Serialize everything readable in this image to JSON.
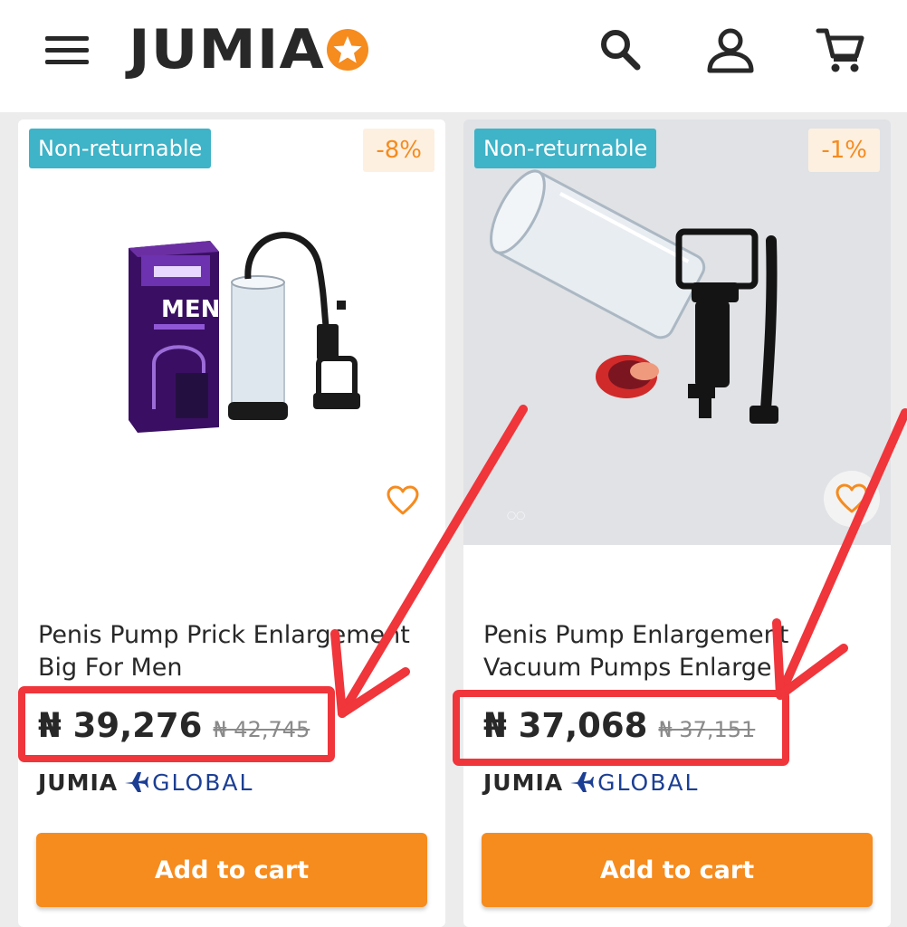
{
  "header": {
    "logo_text": "JUMIA",
    "menu_icon": "hamburger-menu-icon",
    "search_icon": "search-icon",
    "account_icon": "user-icon",
    "cart_icon": "cart-icon"
  },
  "colors": {
    "brand_orange": "#f68b1e",
    "badge_teal": "#3fb3c7",
    "text_dark": "#282828",
    "global_blue": "#1c3f94",
    "annotation_red": "#f0353b"
  },
  "products": [
    {
      "badge": "Non-returnable",
      "discount": "-8%",
      "title": "Penis Pump Prick Enlargement Big For Men",
      "price": "₦ 39,276",
      "old_price": "₦ 42,745",
      "seller_brand": "JUMIA",
      "seller_program": "GLOBAL",
      "cta": "Add to cart"
    },
    {
      "badge": "Non-returnable",
      "discount": "-1%",
      "title": "Penis Pump Enlargement Vacuum Pumps Enlarge",
      "price": "₦ 37,068",
      "old_price": "₦ 37,151",
      "seller_brand": "JUMIA",
      "seller_program": "GLOBAL",
      "cta": "Add to cart"
    }
  ]
}
